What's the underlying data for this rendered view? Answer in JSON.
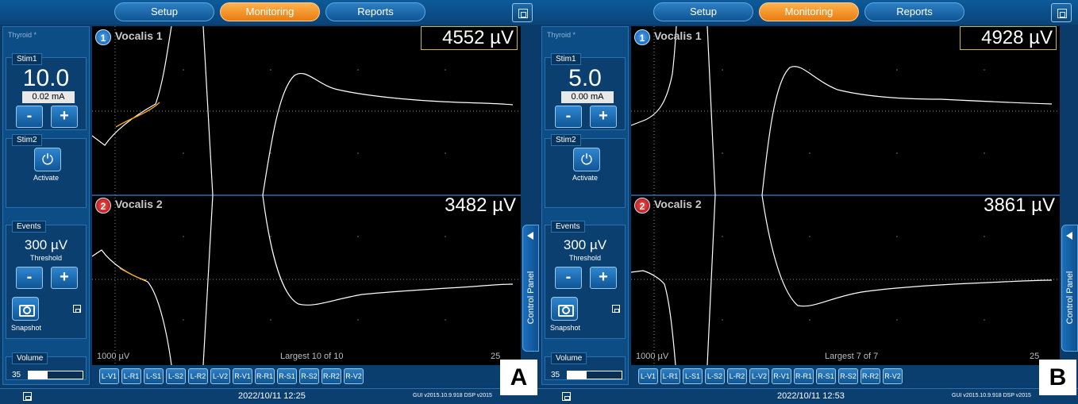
{
  "tabs": {
    "setup": "Setup",
    "monitoring": "Monitoring",
    "reports": "Reports"
  },
  "control_panel_label": "Control Panel",
  "colors": {
    "trace": "#ffffff",
    "highlight": "#f5a623",
    "active_tab": "#f5921e",
    "ch1_badge": "#1f74c6",
    "ch2_badge": "#c81f1f"
  },
  "panels": [
    {
      "corner_label": "A",
      "procedure": "Thyroid *",
      "stim1": {
        "label": "Stim1",
        "value": "10.0",
        "ma": "0.02 mA",
        "minus": "-",
        "plus": "+"
      },
      "stim2": {
        "label": "Stim2",
        "activate": "Activate"
      },
      "events": {
        "label": "Events",
        "threshold_value": "300 µV",
        "threshold_label": "Threshold",
        "minus": "-",
        "plus": "+"
      },
      "snapshot": "Snapshot",
      "volume": {
        "label": "Volume",
        "value": "35",
        "level": 0.35
      },
      "channels": [
        {
          "num": "1",
          "name": "Vocalis 1",
          "amplitude": "4552 µV"
        },
        {
          "num": "2",
          "name": "Vocalis 2",
          "amplitude": "3482 µV"
        }
      ],
      "scale_label": "1000 µV",
      "largest_label": "Largest 10 of 10",
      "time_label": "25",
      "mode_buttons": [
        "L-V1",
        "L-R1",
        "L-S1",
        "L-S2",
        "L-R2",
        "L-V2",
        "R-V1",
        "R-R1",
        "R-S1",
        "R-S2",
        "R-R2",
        "R-V2"
      ],
      "datetime": "2022/10/11 12:25",
      "version": "GUI v2015.10.9.918   DSP v2015"
    },
    {
      "corner_label": "B",
      "procedure": "Thyroid *",
      "stim1": {
        "label": "Stim1",
        "value": "5.0",
        "ma": "0.00 mA",
        "minus": "-",
        "plus": "+"
      },
      "stim2": {
        "label": "Stim2",
        "activate": "Activate"
      },
      "events": {
        "label": "Events",
        "threshold_value": "300 µV",
        "threshold_label": "Threshold",
        "minus": "-",
        "plus": "+"
      },
      "snapshot": "Snapshot",
      "volume": {
        "label": "Volume",
        "value": "35",
        "level": 0.35
      },
      "channels": [
        {
          "num": "1",
          "name": "Vocalis 1",
          "amplitude": "4928 µV"
        },
        {
          "num": "2",
          "name": "Vocalis 2",
          "amplitude": "3861 µV"
        }
      ],
      "scale_label": "1000 µV",
      "largest_label": "Largest 7 of 7",
      "time_label": "25",
      "mode_buttons": [
        "L-V1",
        "L-R1",
        "L-S1",
        "L-S2",
        "L-R2",
        "L-V2",
        "R-V1",
        "R-R1",
        "R-S1",
        "R-S2",
        "R-R2",
        "R-V2"
      ],
      "datetime": "2022/10/11 12:53",
      "version": "GUI v2015.10.9.918   DSP v2015"
    }
  ]
}
